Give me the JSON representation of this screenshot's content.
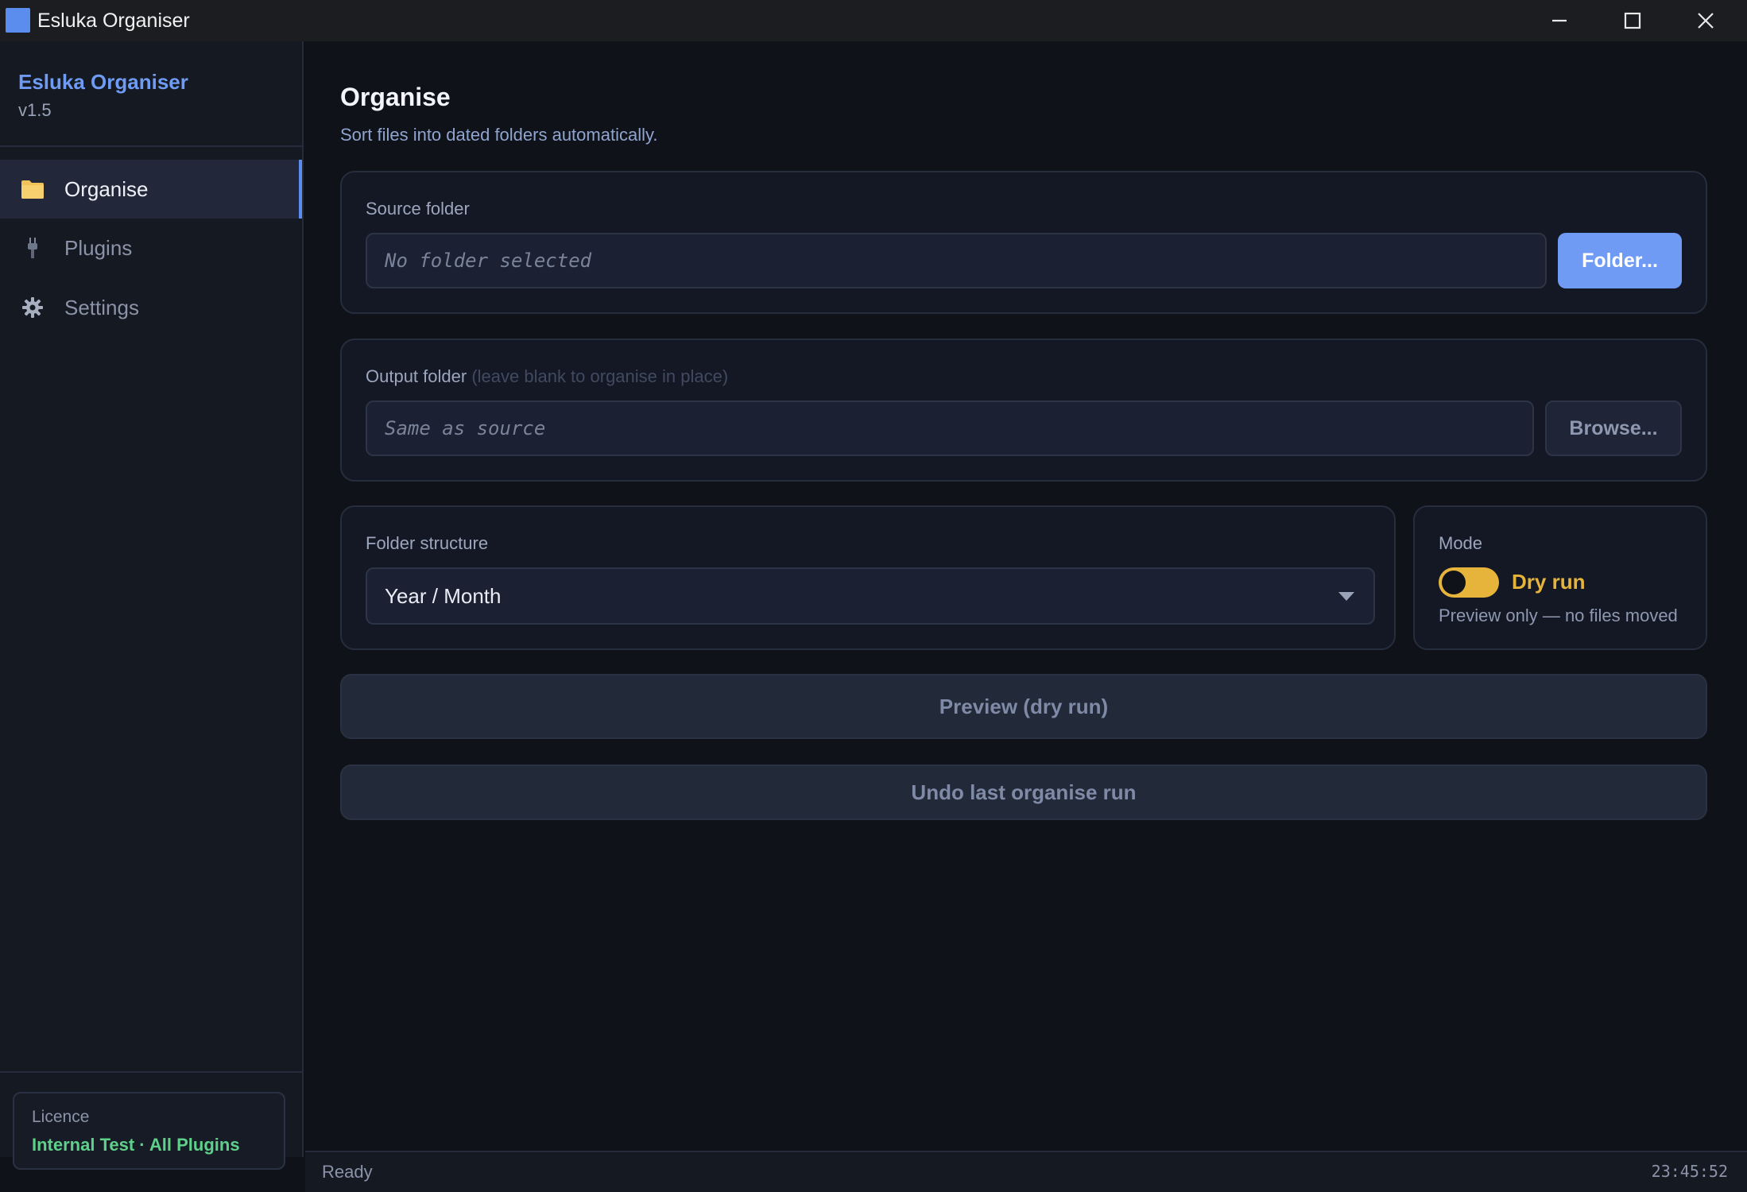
{
  "window": {
    "title": "Esluka Organiser"
  },
  "sidebar": {
    "brand": "Esluka Organiser",
    "version": "v1.5",
    "items": [
      {
        "label": "Organise",
        "icon": "folder-icon",
        "active": true
      },
      {
        "label": "Plugins",
        "icon": "plug-icon",
        "active": false
      },
      {
        "label": "Settings",
        "icon": "gear-icon",
        "active": false
      }
    ],
    "licence": {
      "label": "Licence",
      "value": "Internal Test · All Plugins"
    }
  },
  "main": {
    "title": "Organise",
    "subtitle": "Sort files into dated folders automatically.",
    "source": {
      "label": "Source folder",
      "placeholder": "No folder selected",
      "button": "Folder..."
    },
    "output": {
      "label": "Output folder",
      "hint": "(leave blank to organise in place)",
      "placeholder": "Same as source",
      "button": "Browse..."
    },
    "structure": {
      "label": "Folder structure",
      "selected": "Year / Month"
    },
    "mode": {
      "label": "Mode",
      "toggle_label": "Dry run",
      "toggle_on": true,
      "description": "Preview only — no files moved"
    },
    "preview_button": "Preview (dry run)",
    "undo_button": "Undo last organise run"
  },
  "status": {
    "text": "Ready",
    "time": "23:45:52"
  },
  "colors": {
    "accent": "#6f9bf5",
    "warning": "#e6b43a",
    "success": "#5fd08a",
    "background": "#0f1218"
  }
}
